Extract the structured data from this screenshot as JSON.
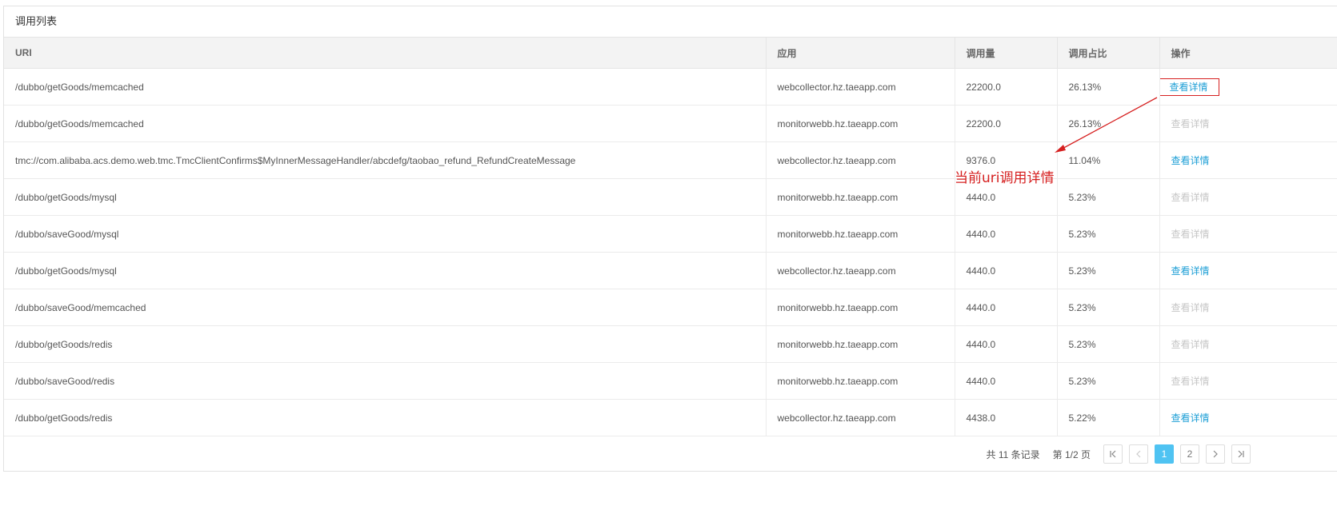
{
  "panel": {
    "title": "调用列表"
  },
  "table": {
    "headers": [
      "URI",
      "应用",
      "调用量",
      "调用占比",
      "操作"
    ],
    "rows": [
      {
        "uri": "/dubbo/getGoods/memcached",
        "app": "webcollector.hz.taeapp.com",
        "count": "22200.0",
        "ratio": "26.13%",
        "action": "查看详情",
        "enabled": true
      },
      {
        "uri": "/dubbo/getGoods/memcached",
        "app": "monitorwebb.hz.taeapp.com",
        "count": "22200.0",
        "ratio": "26.13%",
        "action": "查看详情",
        "enabled": false
      },
      {
        "uri": "tmc://com.alibaba.acs.demo.web.tmc.TmcClientConfirms$MyInnerMessageHandler/abcdefg/taobao_refund_RefundCreateMessage",
        "app": "webcollector.hz.taeapp.com",
        "count": "9376.0",
        "ratio": "11.04%",
        "action": "查看详情",
        "enabled": true
      },
      {
        "uri": "/dubbo/getGoods/mysql",
        "app": "monitorwebb.hz.taeapp.com",
        "count": "4440.0",
        "ratio": "5.23%",
        "action": "查看详情",
        "enabled": false
      },
      {
        "uri": "/dubbo/saveGood/mysql",
        "app": "monitorwebb.hz.taeapp.com",
        "count": "4440.0",
        "ratio": "5.23%",
        "action": "查看详情",
        "enabled": false
      },
      {
        "uri": "/dubbo/getGoods/mysql",
        "app": "webcollector.hz.taeapp.com",
        "count": "4440.0",
        "ratio": "5.23%",
        "action": "查看详情",
        "enabled": true
      },
      {
        "uri": "/dubbo/saveGood/memcached",
        "app": "monitorwebb.hz.taeapp.com",
        "count": "4440.0",
        "ratio": "5.23%",
        "action": "查看详情",
        "enabled": false
      },
      {
        "uri": "/dubbo/getGoods/redis",
        "app": "monitorwebb.hz.taeapp.com",
        "count": "4440.0",
        "ratio": "5.23%",
        "action": "查看详情",
        "enabled": false
      },
      {
        "uri": "/dubbo/saveGood/redis",
        "app": "monitorwebb.hz.taeapp.com",
        "count": "4440.0",
        "ratio": "5.23%",
        "action": "查看详情",
        "enabled": false
      },
      {
        "uri": "/dubbo/getGoods/redis",
        "app": "webcollector.hz.taeapp.com",
        "count": "4438.0",
        "ratio": "5.22%",
        "action": "查看详情",
        "enabled": true
      }
    ]
  },
  "footer": {
    "total": "共 11 条记录",
    "page_info": "第 1/2 页",
    "pages": [
      "1",
      "2"
    ],
    "current_page": "1"
  },
  "annotation": {
    "text": "当前uri调用详情",
    "color": "#d62020"
  },
  "colors": {
    "link": "#1e9fd6",
    "link_disabled": "#c6c6c6",
    "active_page": "#4fc3f2"
  },
  "icons": {
    "first": "first-page-icon",
    "prev": "prev-page-icon",
    "next": "next-page-icon",
    "last": "last-page-icon"
  }
}
